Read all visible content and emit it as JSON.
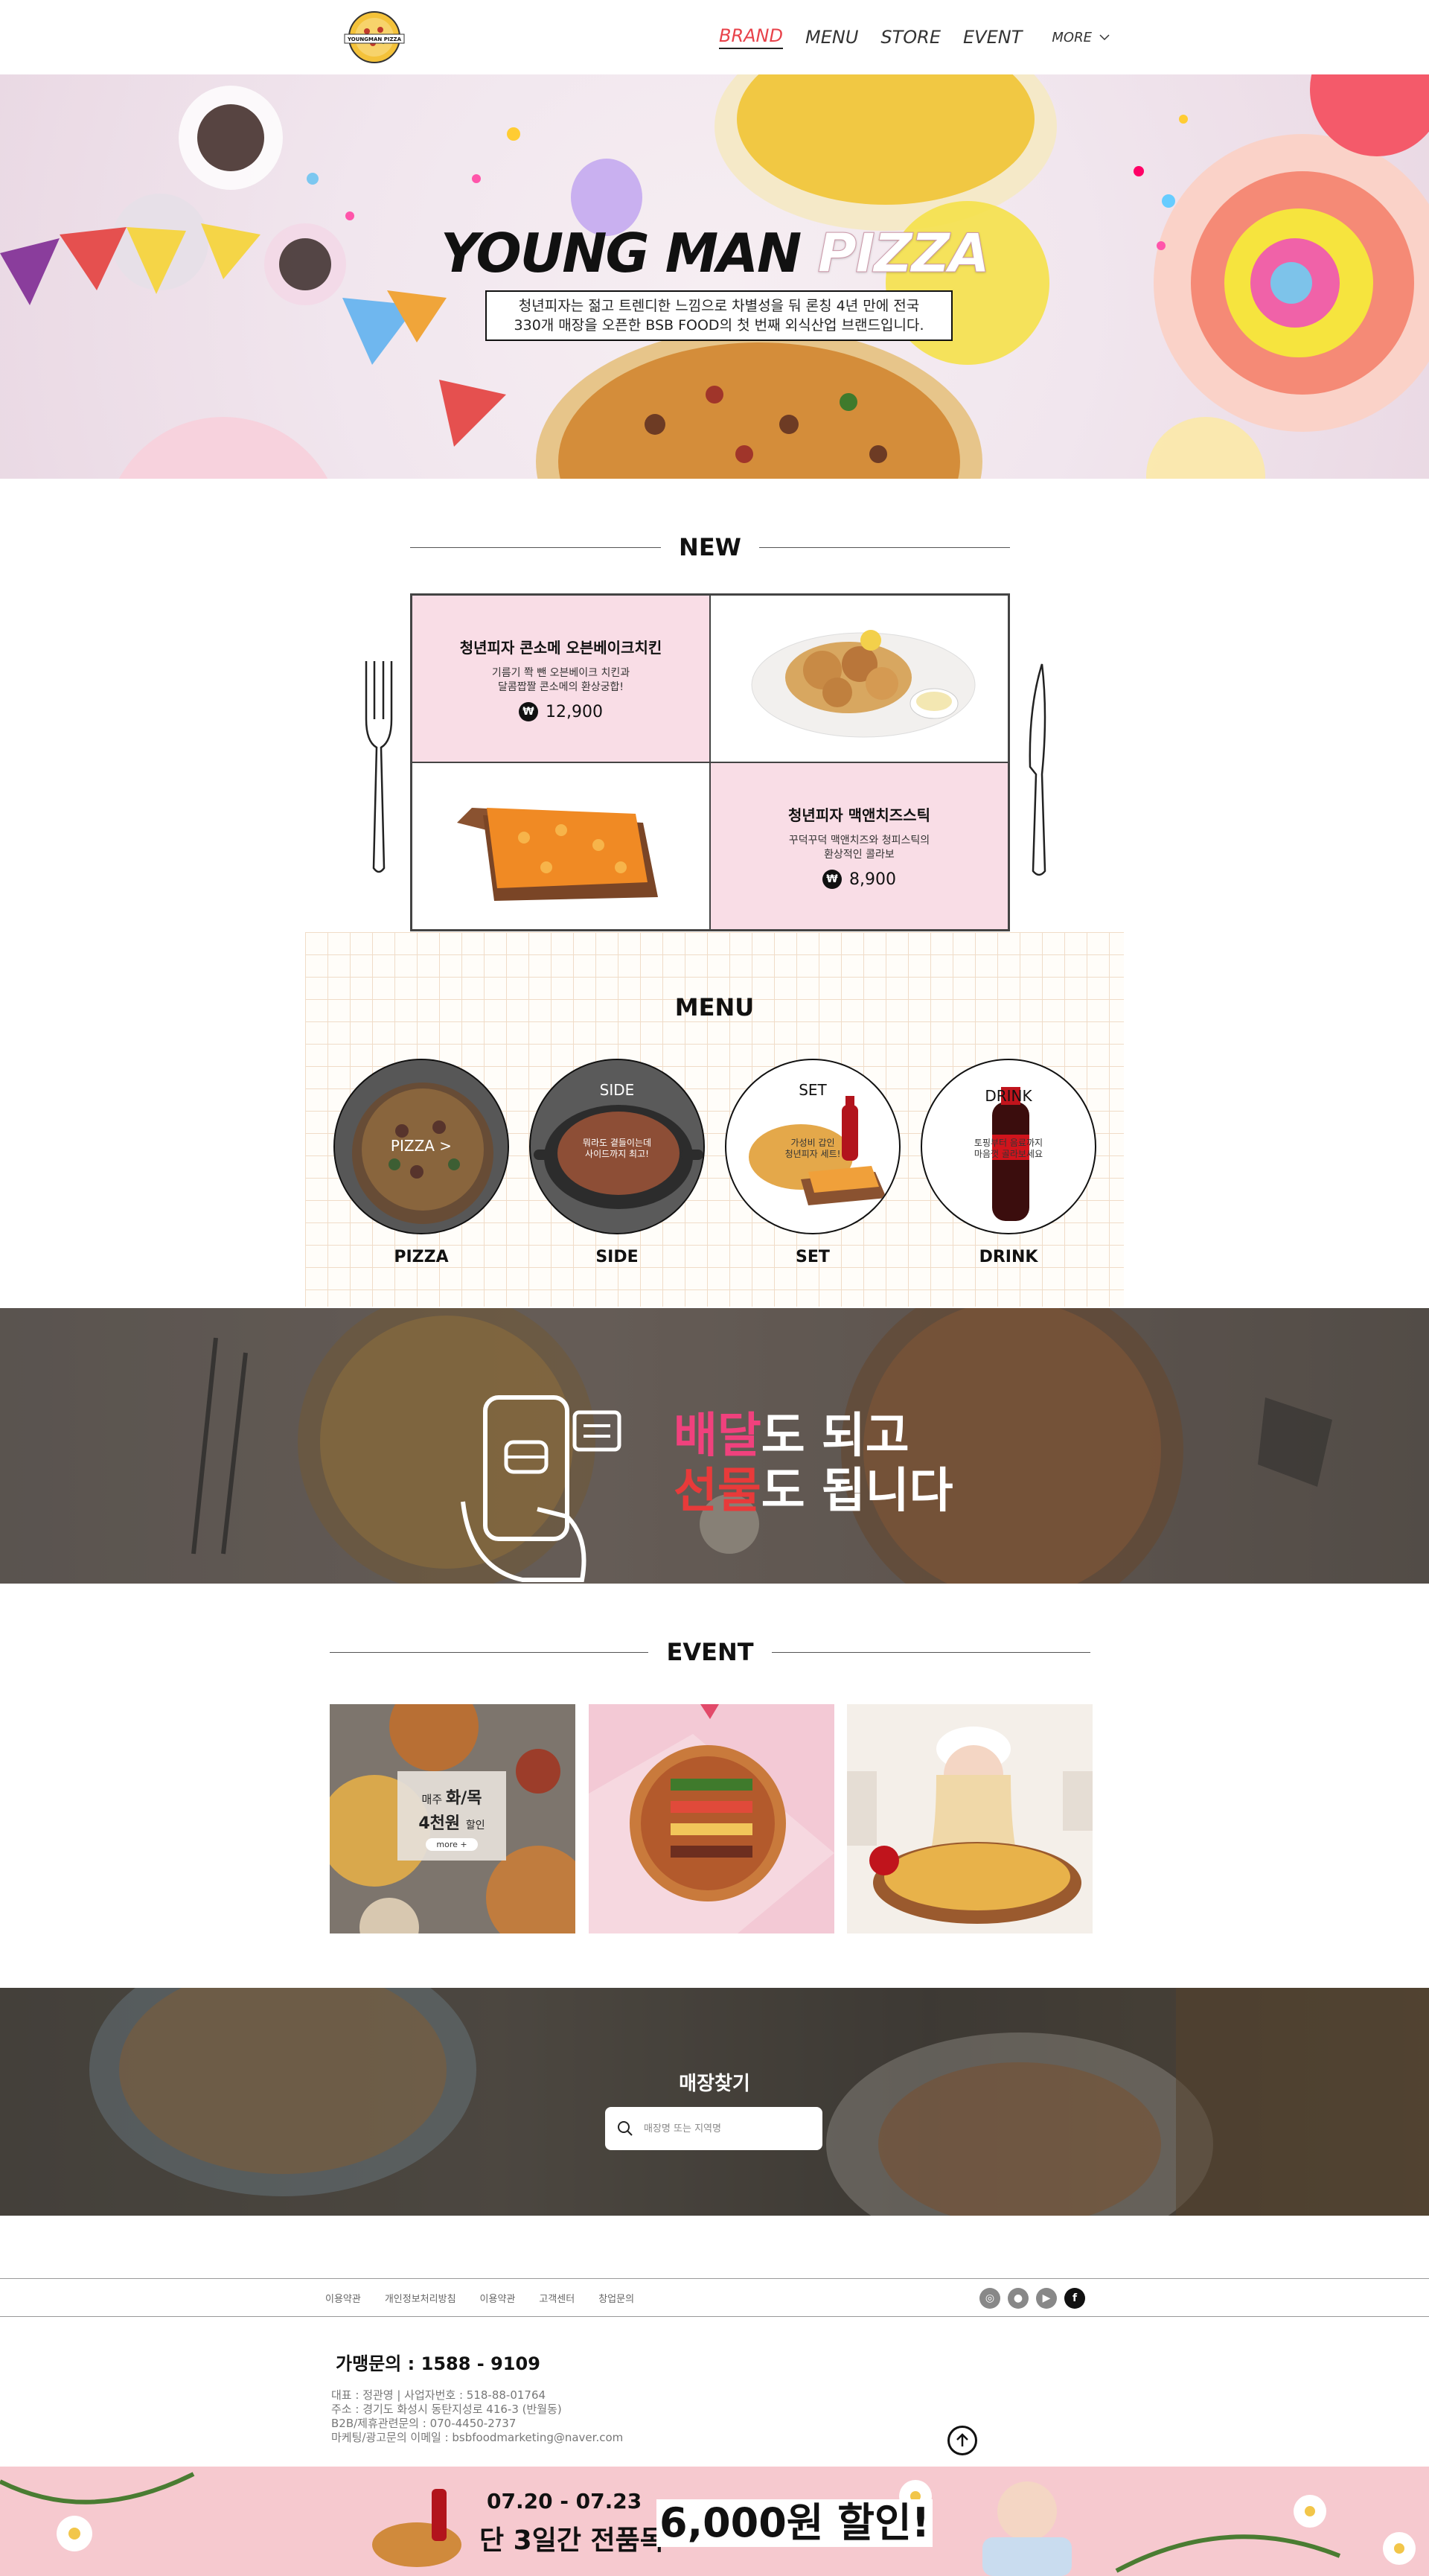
{
  "header": {
    "logo_text": "YOUNGMAN PIZZA",
    "nav": [
      "BRAND",
      "MENU",
      "STORE",
      "EVENT"
    ],
    "more_label": "MORE"
  },
  "hero": {
    "title_dark": "YOUNG MAN",
    "title_light": "PIZZA",
    "desc_line1": "청년피자는 젊고 트렌디한 느낌으로 차별성을 둬 론칭 4년 만에 전국",
    "desc_line2": "330개 매장을 오픈한 BSB FOOD의 첫 번째 외식산업 브랜드입니다."
  },
  "new_section": {
    "title": "NEW",
    "items": [
      {
        "name": "청년피자 콘소메 오븐베이크치킨",
        "desc_line1": "기름기 쫙 뺀 오븐베이크 치킨과",
        "desc_line2": "달콤짭짤 콘소메의 환상궁합!",
        "currency": "₩",
        "price": "12,900"
      },
      {
        "name": "청년피자 맥앤치즈스틱",
        "desc_line1": "꾸덕꾸덕 맥앤치즈와 청피스틱의",
        "desc_line2": "환상적인 콜라보",
        "currency": "₩",
        "price": "8,900"
      }
    ]
  },
  "menu_section": {
    "title": "MENU",
    "items": [
      {
        "label": "PIZZA",
        "caption": "PIZZA >",
        "sub": ""
      },
      {
        "label": "SIDE",
        "caption": "SIDE",
        "sub": "뭐라도 곁들이는데\n사이드까지 최고!"
      },
      {
        "label": "SET",
        "caption": "SET",
        "sub": "가성비 갑인\n청년피자 세트!"
      },
      {
        "label": "DRINK",
        "caption": "DRINK",
        "sub": "토핑부터 음료까지\n마음껏 골라보세요"
      }
    ]
  },
  "delivery": {
    "hl1": "배달",
    "rest1": "도 되고",
    "hl2": "선물",
    "rest2": "도 됩니다"
  },
  "event_section": {
    "title": "EVENT",
    "card1": {
      "prefix": "매주",
      "days": "화/목",
      "amount": "4천원",
      "suffix": "할인",
      "more": "more +"
    }
  },
  "store_finder": {
    "title": "매장찾기",
    "placeholder": "매장명 또는 지역명"
  },
  "footer": {
    "links": [
      "이용약관",
      "개인정보처리방침",
      "이용약관",
      "고객센터",
      "창업문의"
    ],
    "contact": "가맹문의 : 1588 - 9109",
    "biz_lines": [
      "대표 : 정관영  |  사업자번호 : 518-88-01764",
      "주소 : 경기도 화성시 동탄지성로 416-3 (반월동)",
      "B2B/제휴관련문의 : 070-4450-2737",
      "마케팅/광고문의 이메일 : bsbfoodmarketing@naver.com"
    ]
  },
  "promo": {
    "date": "07.20 - 07.23",
    "main": "단 3일간 전품목",
    "discount": "6,000원 할인!"
  },
  "colors": {
    "accent_red": "#e8424a",
    "pink": "#f9dde6",
    "promo_pink": "#f6c9cf"
  }
}
